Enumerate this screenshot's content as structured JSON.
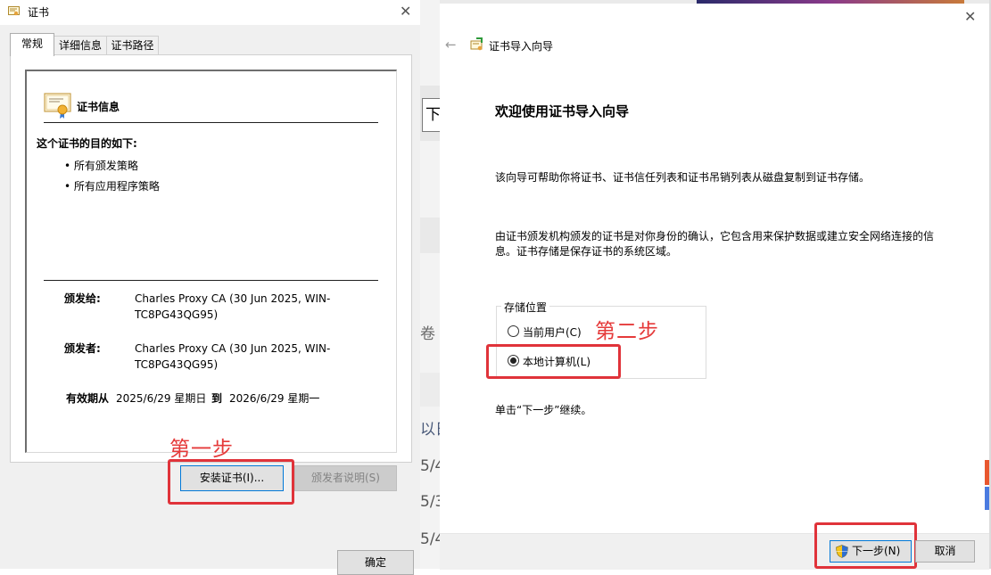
{
  "cert_dialog": {
    "title": "证书",
    "tabs": [
      {
        "label": "常规",
        "active": true
      },
      {
        "label": "详细信息",
        "active": false
      },
      {
        "label": "证书路径",
        "active": false
      }
    ],
    "info_heading": "证书信息",
    "purpose_heading": "这个证书的目的如下:",
    "purposes": [
      "• 所有颁发策略",
      "• 所有应用程序策略"
    ],
    "issued_to_label": "颁发给:",
    "issued_to_value": "Charles Proxy CA (30 Jun 2025, WIN-TC8PG43QG95)",
    "issued_by_label": "颁发者:",
    "issued_by_value": "Charles Proxy CA (30 Jun 2025, WIN-TC8PG43QG95)",
    "validity_label": "有效期从",
    "valid_from": "2025/6/29 星期日",
    "to_label": "到",
    "valid_to": "2026/6/29 星期一",
    "install_button": "安装证书(I)...",
    "issuer_statement_button": "颁发者说明(S)",
    "ok_button": "确定",
    "step1_annotation": "第一步"
  },
  "background_window": {
    "fragments": [
      "下",
      "卷",
      "以日",
      "5/4",
      "5/3",
      "5/4"
    ]
  },
  "wizard": {
    "title": "证书导入向导",
    "heading": "欢迎使用证书导入向导",
    "para1": "该向导可帮助你将证书、证书信任列表和证书吊销列表从磁盘复制到证书存储。",
    "para2_line1": "由证书颁发机构颁发的证书是对你身份的确认，它包含用来保护数据或建立安全网络连接的信",
    "para2_line2": "息。证书存储是保存证书的系统区域。",
    "store_location_label": "存储位置",
    "options": [
      {
        "label": "当前用户(C)",
        "checked": false
      },
      {
        "label": "本地计算机(L)",
        "checked": true
      }
    ],
    "step2_annotation": "第二步",
    "continue_hint": "单击“下一步”继续。",
    "next_button": "下一步(N)",
    "cancel_button": "取消"
  },
  "colors": {
    "annotation_red": "#e0333a",
    "dialog_bg": "#f0f0f0",
    "focus_blue": "#0078d7"
  }
}
